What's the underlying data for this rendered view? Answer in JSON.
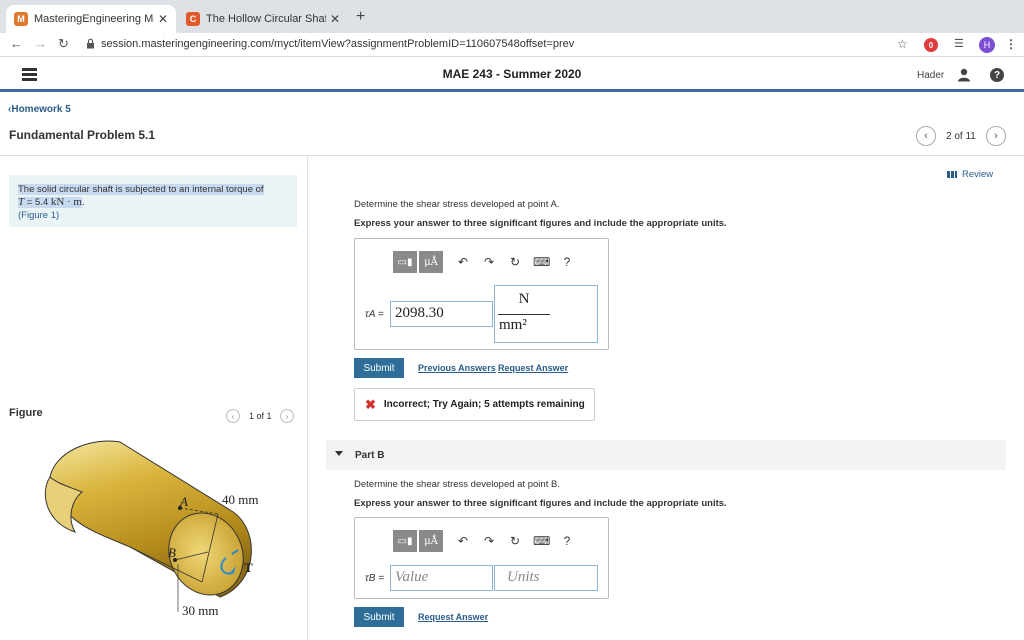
{
  "browser": {
    "tabs": [
      {
        "title": "MasteringEngineering Masterin",
        "favicon": "M"
      },
      {
        "title": "The Hollow Circular Shaft Is Su",
        "favicon": "C"
      }
    ],
    "new_tab": "+",
    "url": "session.masteringengineering.com/myct/itemView?assignmentProblemID=110607548offset=prev",
    "profile_initial": "H",
    "adblock_label": "0"
  },
  "header": {
    "course_title": "MAE 243 - Summer 2020",
    "user_name": "Hader",
    "help": "?"
  },
  "assignment": {
    "back_link": "Homework 5",
    "problem_title": "Fundamental Problem 5.1",
    "pager_text": "2 of 11",
    "review_label": "Review"
  },
  "problem": {
    "line1": "The solid circular shaft is subjected to an internal torque of",
    "torque_sym": "T",
    "torque_eq": " = 5.4 ",
    "torque_unit": "kN · m",
    "figure_link": "(Figure 1)"
  },
  "figure": {
    "label": "Figure",
    "count": "1 of 1",
    "dim_outer": "40 mm",
    "dim_inner": "30 mm",
    "point_a": "A",
    "point_b": "B",
    "torque": "T"
  },
  "part_a": {
    "question": "Determine the shear stress developed at point A.",
    "instruction": "Express your answer to three significant figures and include the appropriate units.",
    "var_label": "τA =",
    "value": "2098.30",
    "unit_num": "N",
    "unit_den": "mm²",
    "submit": "Submit",
    "prev_answers": "Previous Answers",
    "request_answer": "Request Answer",
    "feedback": "Incorrect; Try Again; 5 attempts remaining"
  },
  "part_b": {
    "title": "Part B",
    "question": "Determine the shear stress developed at point B.",
    "instruction": "Express your answer to three significant figures and include the appropriate units.",
    "var_label": "τB =",
    "value_placeholder": "Value",
    "units_placeholder": "Units",
    "submit": "Submit",
    "request_answer": "Request Answer"
  },
  "toolbar": {
    "mu_label": "μÅ",
    "help": "?"
  }
}
